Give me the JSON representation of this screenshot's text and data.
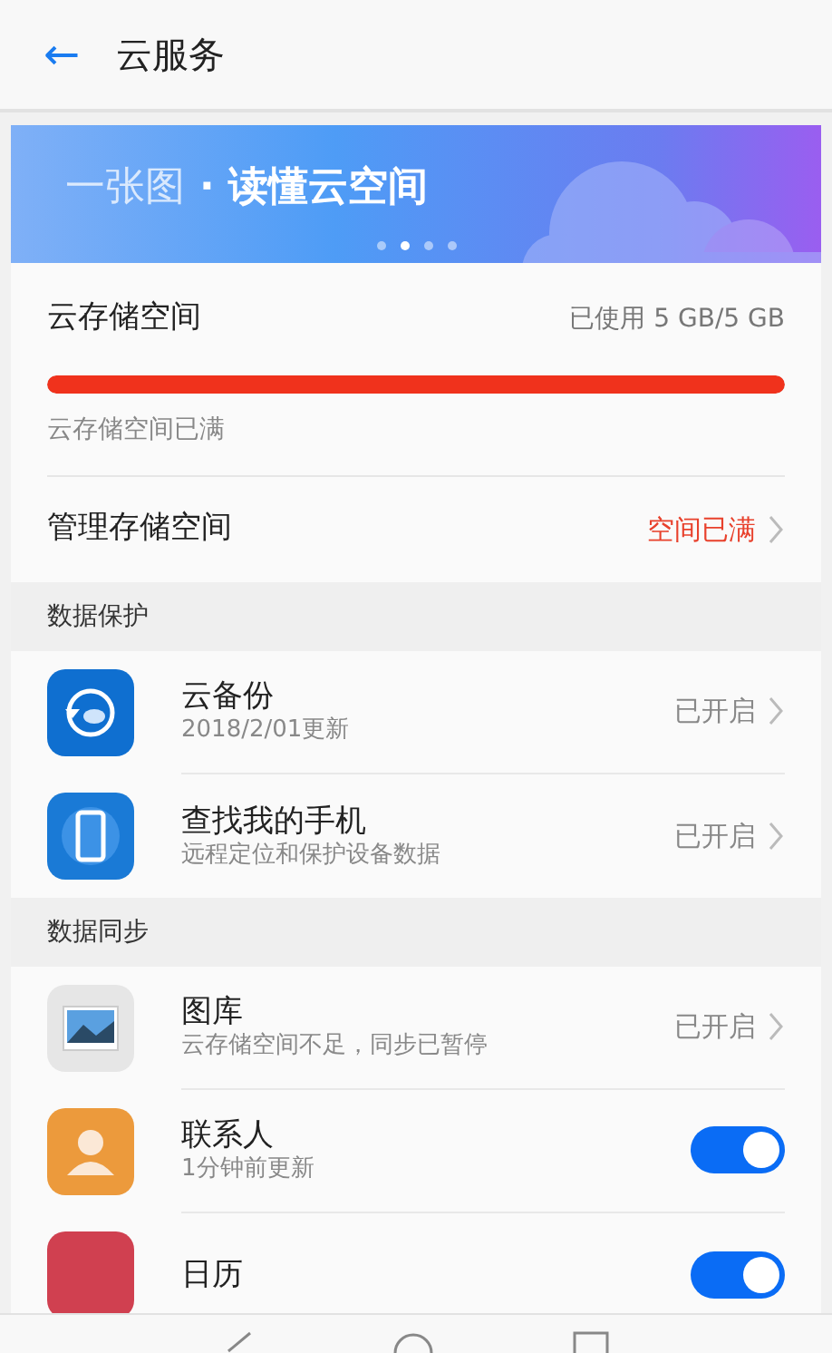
{
  "header": {
    "back": "←",
    "title": "云服务"
  },
  "banner": {
    "light": "一张图",
    "bold": "· 读懂云空间",
    "dots": [
      {
        "selected": false
      },
      {
        "selected": true
      },
      {
        "selected": false
      },
      {
        "selected": false
      }
    ]
  },
  "storage": {
    "label": "云存储空间",
    "usage": "已使用 5 GB/5 GB",
    "level": 1.0,
    "note": "云存储空间已满"
  },
  "manage": {
    "label": "管理存储空间",
    "status": "空间已满"
  },
  "sections": [
    {
      "title": "数据保护",
      "items": [
        {
          "kind": "status",
          "title": "云备份",
          "subtitle": "2018/2/01更新",
          "status": "已开启"
        },
        {
          "kind": "status",
          "title": "查找我的手机",
          "subtitle": "远程定位和保护设备数据",
          "status": "已开启"
        }
      ]
    },
    {
      "title": "数据同步",
      "items": [
        {
          "kind": "status",
          "title": "图库",
          "subtitle": "云存储空间不足，同步已暂停",
          "status": "已开启"
        },
        {
          "kind": "toggle",
          "title": "联系人",
          "subtitle": "1分钟前更新",
          "on": true
        },
        {
          "kind": "toggle",
          "title": "日历",
          "on": true
        }
      ]
    }
  ]
}
